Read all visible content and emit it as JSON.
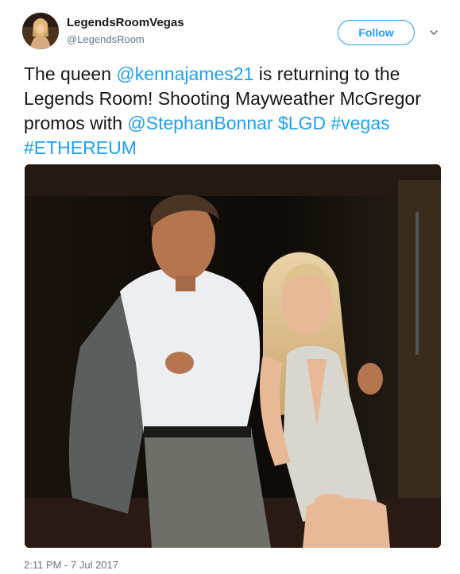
{
  "account": {
    "display_name": "LegendsRoomVegas",
    "handle": "@LegendsRoom",
    "avatar_icon": "profile-photo"
  },
  "actions": {
    "follow_label": "Follow",
    "menu_icon": "chevron-down-icon"
  },
  "tweet": {
    "segments": [
      {
        "text": "The queen ",
        "type": "plain"
      },
      {
        "text": "@kennajames21",
        "type": "mention"
      },
      {
        "text": " is returning to the Legends Room! Shooting Mayweather McGregor promos with ",
        "type": "plain"
      },
      {
        "text": "@StephanBonnar",
        "type": "mention"
      },
      {
        "text": " ",
        "type": "plain"
      },
      {
        "text": "$LGD",
        "type": "cashtag"
      },
      {
        "text": " ",
        "type": "plain"
      },
      {
        "text": "#vegas",
        "type": "hashtag"
      },
      {
        "text": " ",
        "type": "plain"
      },
      {
        "text": "#ETHEREUM",
        "type": "hashtag"
      }
    ],
    "timestamp": "2:11 PM - 7 Jul 2017"
  },
  "colors": {
    "link": "#1da1f2",
    "text": "#14171a",
    "muted": "#657786"
  }
}
